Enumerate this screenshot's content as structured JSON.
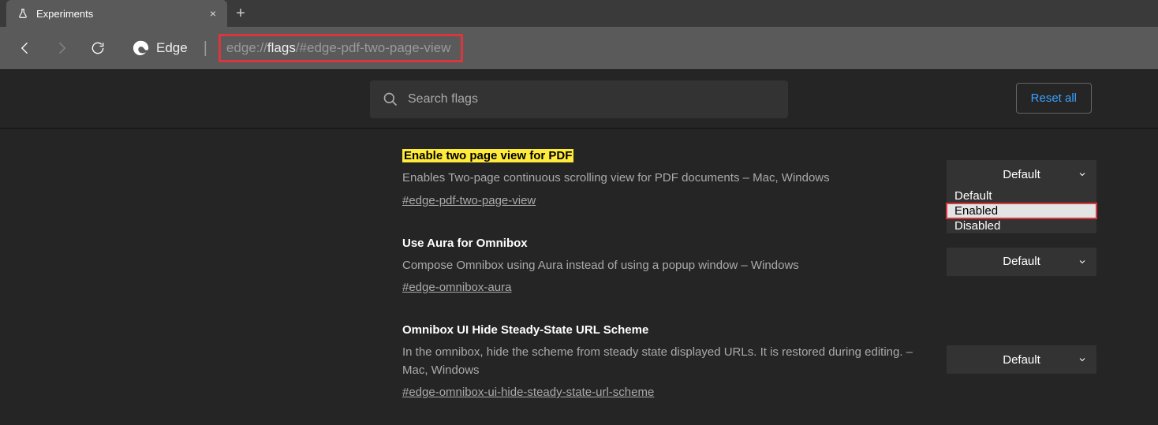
{
  "tab": {
    "title": "Experiments"
  },
  "addr": {
    "brand": "Edge",
    "prefix": "edge://",
    "host": "flags",
    "suffix": "/#edge-pdf-two-page-view"
  },
  "topbar": {
    "search_placeholder": "Search flags",
    "reset": "Reset all"
  },
  "flags": [
    {
      "title": "Enable two page view for PDF",
      "highlight": true,
      "desc": "Enables Two-page continuous scrolling view for PDF documents – Mac, Windows",
      "anchor": "#edge-pdf-two-page-view",
      "selected": "Default",
      "dropdown_open": true,
      "options": [
        "Default",
        "Enabled",
        "Disabled"
      ],
      "dropdown_selected": "Enabled"
    },
    {
      "title": "Use Aura for Omnibox",
      "highlight": false,
      "desc": "Compose Omnibox using Aura instead of using a popup window – Windows",
      "anchor": "#edge-omnibox-aura",
      "selected": "Default"
    },
    {
      "title": "Omnibox UI Hide Steady-State URL Scheme",
      "highlight": false,
      "desc": "In the omnibox, hide the scheme from steady state displayed URLs. It is restored during editing. – Mac, Windows",
      "anchor": "#edge-omnibox-ui-hide-steady-state-url-scheme",
      "selected": "Default"
    }
  ]
}
